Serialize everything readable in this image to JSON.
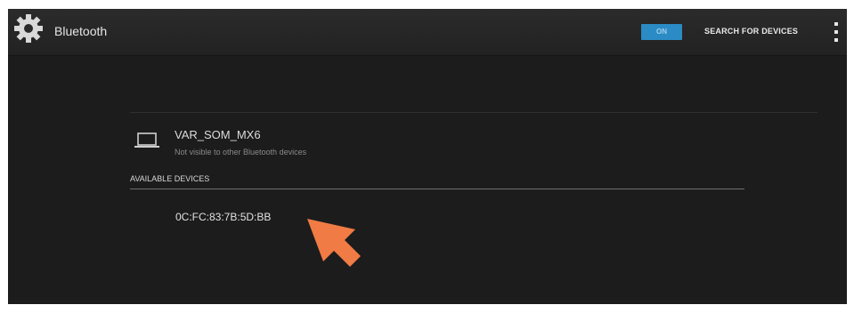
{
  "action_bar": {
    "title": "Bluetooth",
    "toggle_label": "ON",
    "search_label": "SEARCH FOR DEVICES",
    "icons": [
      "settings-gear-icon",
      "overflow-menu-icon"
    ]
  },
  "local_device": {
    "name": "VAR_SOM_MX6",
    "status": "Not visible to other Bluetooth devices",
    "icon": "laptop-icon"
  },
  "available": {
    "header": "AVAILABLE DEVICES",
    "devices": [
      {
        "address": "0C:FC:83:7B:5D:BB"
      }
    ]
  },
  "colors": {
    "background": "#1c1c1c",
    "action_bar": "#262626",
    "toggle_on": "#2b8bc4",
    "pointer": "#f07b45"
  }
}
